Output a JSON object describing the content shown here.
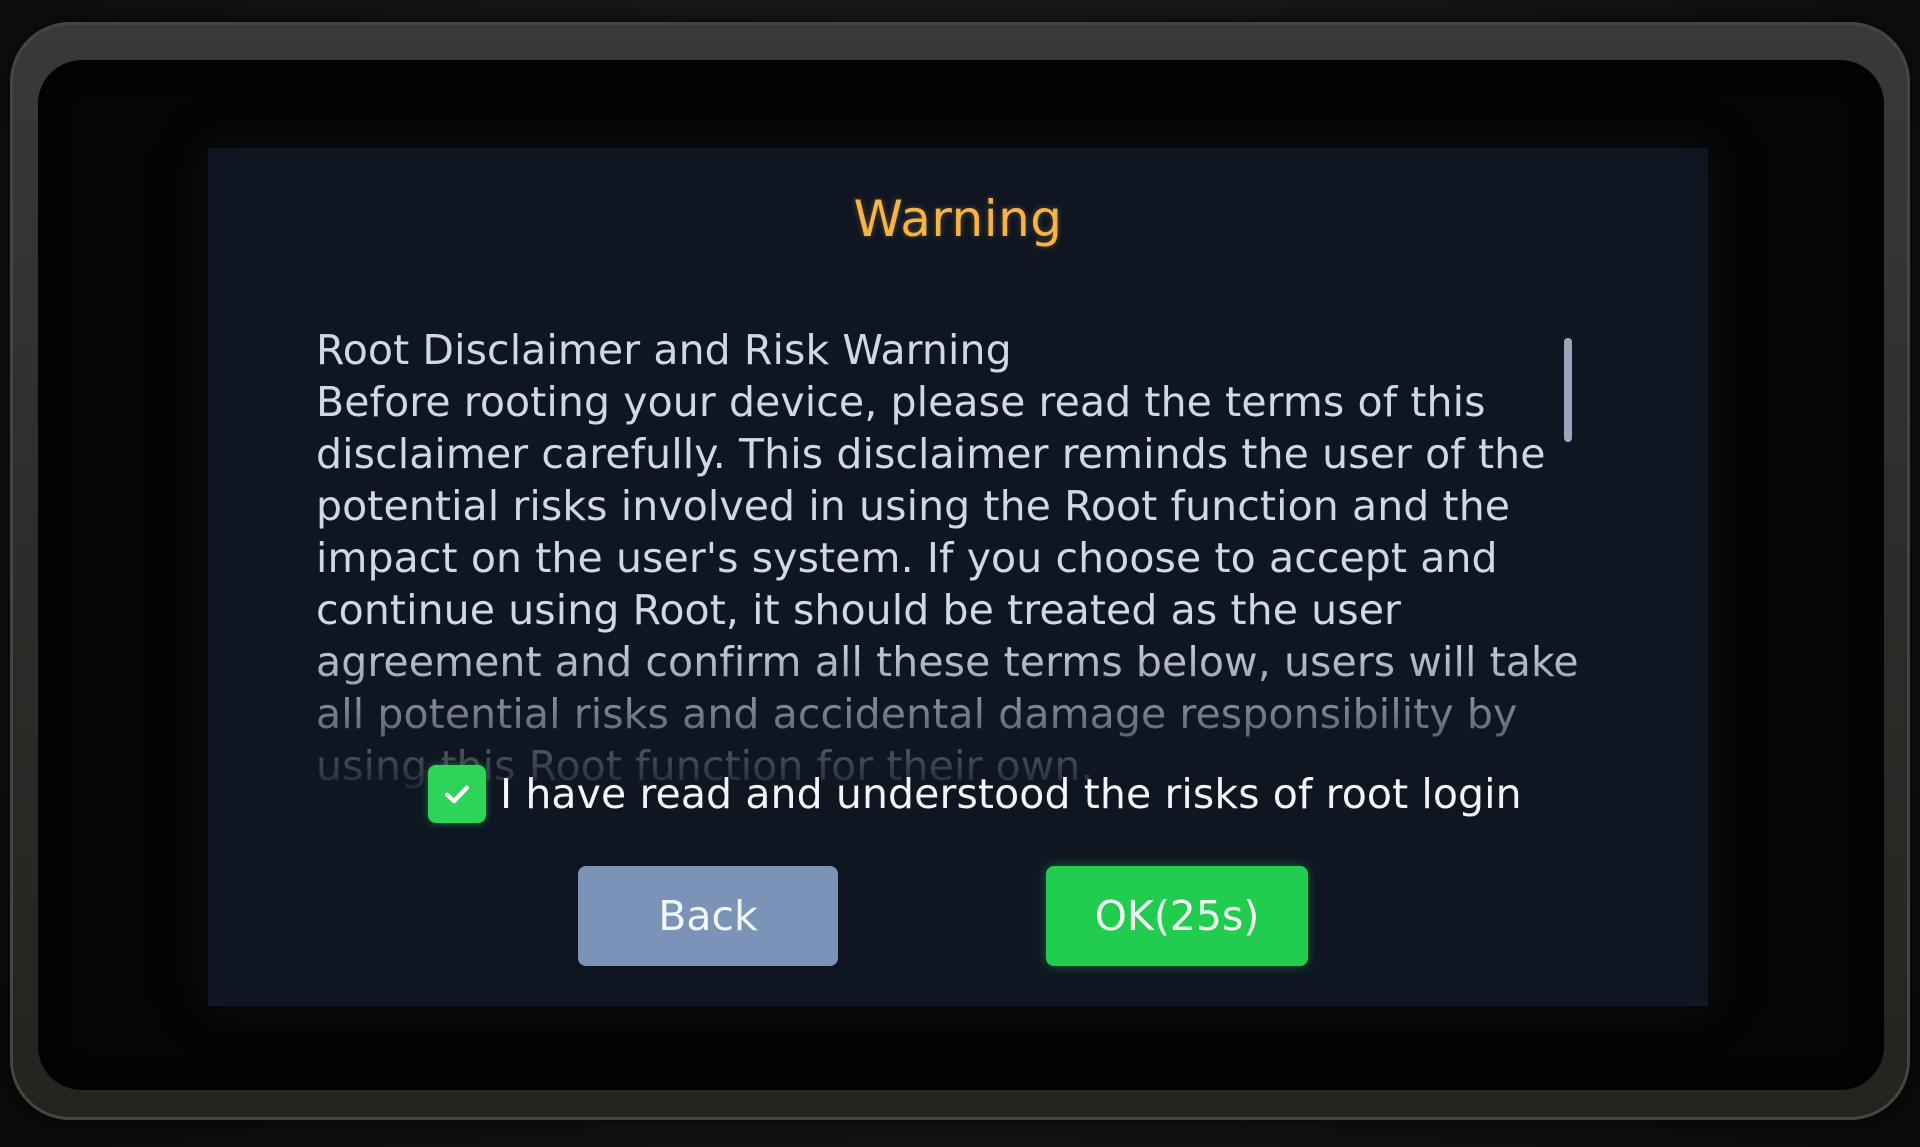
{
  "dialog": {
    "title": "Warning",
    "disclaimer_heading": "Root Disclaimer and Risk Warning",
    "disclaimer_body": "Before rooting your device, please read the terms of this disclaimer carefully. This disclaimer reminds the user of the potential risks involved in using the Root function and the impact on the user's system. If you choose to accept and continue using Root, it should be treated as the user agreement and confirm all these terms below, users will take all potential risks and accidental damage responsibility by using this Root function for their own.",
    "consent": {
      "checked": true,
      "label": "I have read and understood the risks of root login"
    },
    "buttons": {
      "back_label": "Back",
      "ok_label": "OK(25s)"
    }
  },
  "colors": {
    "title": "#f5b445",
    "screen_background": "#0f1622",
    "body_text": "#cfd9e6",
    "checkbox": "#2ed35a",
    "back_button": "#7b93b7",
    "ok_button": "#22cc4e"
  },
  "icons": {
    "checkbox": "check-icon"
  }
}
